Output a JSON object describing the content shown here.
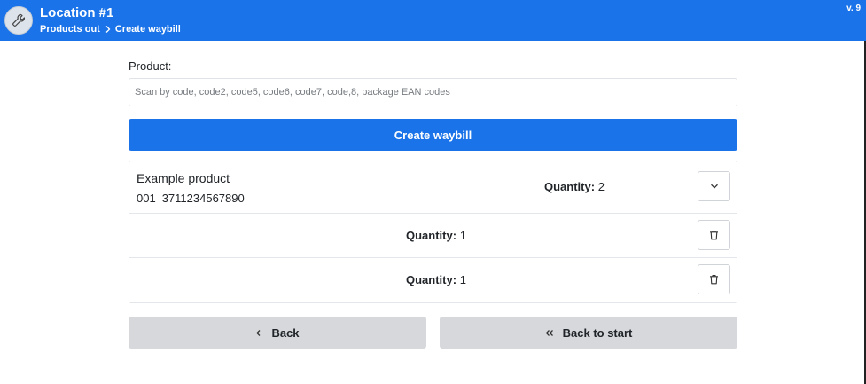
{
  "header": {
    "title": "Location #1",
    "breadcrumb": [
      "Products out",
      "Create waybill"
    ],
    "version": "v. 9",
    "app_icon": "wrench-icon"
  },
  "form": {
    "product_label": "Product:",
    "product_placeholder": "Scan by code, code2, code5, code6, code7, code,8, package EAN codes",
    "product_value": "",
    "create_button": "Create waybill"
  },
  "items": [
    {
      "name": "Example product",
      "code": "001",
      "ean": "3711234567890",
      "quantity_label": "Quantity:",
      "quantity": "2",
      "action_icon": "chevron-down-icon",
      "sub_rows": [
        {
          "quantity_label": "Quantity:",
          "quantity": "1",
          "action_icon": "trash-icon"
        },
        {
          "quantity_label": "Quantity:",
          "quantity": "1",
          "action_icon": "trash-icon"
        }
      ]
    }
  ],
  "footer": {
    "back_label": "Back",
    "back_icon": "chevron-left-icon",
    "back_to_start_label": "Back to start",
    "back_to_start_icon": "double-chevron-left-icon"
  },
  "colors": {
    "primary": "#1a73e8",
    "secondary_button": "#d6d8db",
    "border": "#e3e6ea"
  }
}
